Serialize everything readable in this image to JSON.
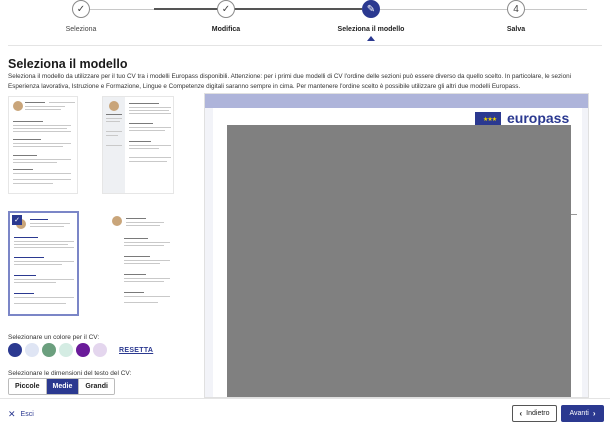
{
  "stepper": {
    "steps": [
      {
        "label": "Seleziona",
        "state": "done"
      },
      {
        "label": "Modifica",
        "state": "done"
      },
      {
        "label": "Seleziona il modello",
        "state": "active"
      },
      {
        "label": "Salva",
        "number": "4",
        "state": "pending"
      }
    ]
  },
  "main": {
    "title": "Seleziona il modello",
    "intro": "Seleziona il modello da utilizzare per il tuo CV tra i modelli Europass disponibili. Attenzione: per i primi due modelli di CV l'ordine delle sezioni può essere diverso da quello scelto. In particolare, le sezioni Esperienza lavorativa, Istruzione e Formazione, Lingue e Competenze digitali saranno sempre in cima. Per mantenere l'ordine scelto è possibile utilizzare gli altri due modelli Europass."
  },
  "preview": {
    "logo_text": "europass"
  },
  "colors": {
    "label": "Selezionare un colore per il CV:",
    "swatches": [
      "#2b3990",
      "#dfe5f4",
      "#6b9f7e",
      "#d4ece3",
      "#6a1b9a",
      "#e4d6ee"
    ],
    "reset_label": "RESETTA"
  },
  "text_size": {
    "label": "Selezionare le dimensioni del testo del CV:",
    "options": [
      "Piccole",
      "Medie",
      "Grandi"
    ],
    "selected": "Medie"
  },
  "footer": {
    "exit_label": "Esci",
    "back_label": "Indietro",
    "next_label": "Avanti"
  },
  "colors_theme": {
    "accent": "#2b3990"
  }
}
